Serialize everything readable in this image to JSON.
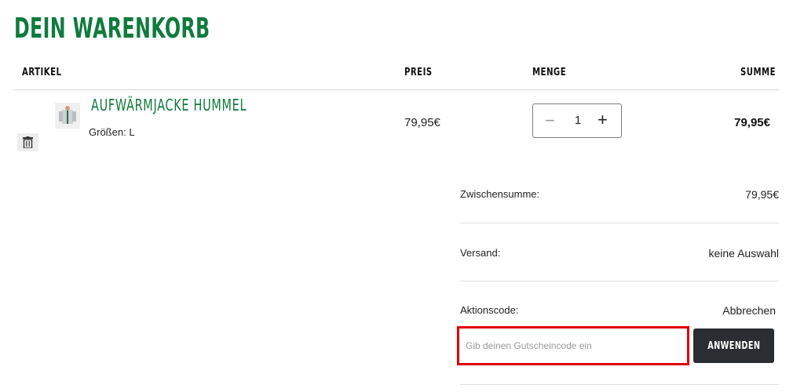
{
  "page": {
    "title": "DEIN WARENKORB"
  },
  "table": {
    "headers": {
      "item": "ARTIKEL",
      "price": "PREIS",
      "quantity": "MENGE",
      "sum": "SUMME"
    }
  },
  "item": {
    "name": "AUFWÄRMJACKE HUMMEL",
    "size_label": "Größen:",
    "size_value": "L",
    "price": "79,95€",
    "quantity": "1",
    "minus_symbol": "−",
    "plus_symbol": "+",
    "total": "79,95€",
    "thumbnail_icon": "jacket-thumbnail",
    "delete_icon": "trash-icon"
  },
  "summary": {
    "subtotal_label": "Zwischensumme:",
    "subtotal_value": "79,95€",
    "shipping_label": "Versand:",
    "shipping_value": "keine Auswahl",
    "promo_label": "Aktionscode:",
    "promo_cancel": "Abbrechen",
    "promo_placeholder": "Gib deinen Gutscheincode ein",
    "promo_input_value": "",
    "apply_label": "ANWENDEN"
  },
  "colors": {
    "brand_green": "#0f7b3c",
    "button_dark": "#2a2e33",
    "highlight_red": "#e00000"
  }
}
